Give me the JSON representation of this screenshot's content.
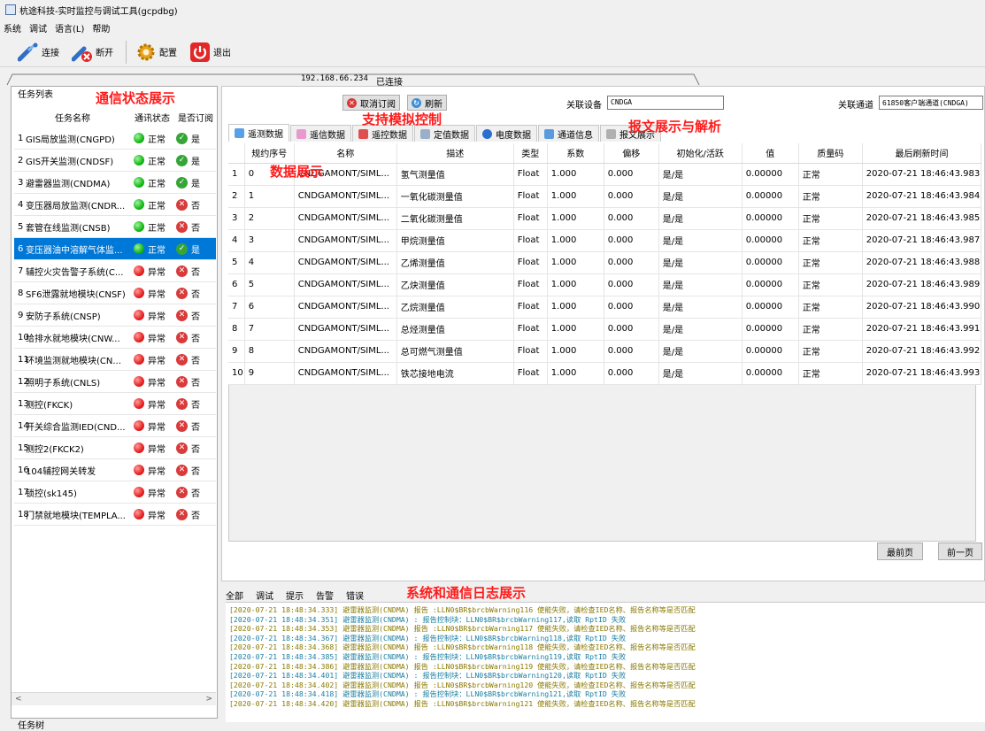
{
  "window": {
    "title": "杭途科技-实时监控与调试工具(gcpdbg)"
  },
  "menu": [
    "系统",
    "调试",
    "语言(L)",
    "帮助"
  ],
  "toolbar": {
    "connect": "连接",
    "disconnect": "断开",
    "config": "配置",
    "exit": "退出"
  },
  "address_bar": {
    "ip": "192.168.66.234",
    "status": "已连接"
  },
  "left_panel": {
    "title": "任务列表",
    "columns": [
      "任务名称",
      "通讯状态",
      "是否订阅"
    ],
    "footer": "任务树",
    "tasks": [
      {
        "num": "1",
        "name": "GIS局放监测(CNGPD)",
        "status": "正常",
        "status_ok": true,
        "sub": "是",
        "sub_yes": true
      },
      {
        "num": "2",
        "name": "GIS开关监测(CNDSF)",
        "status": "正常",
        "status_ok": true,
        "sub": "是",
        "sub_yes": true
      },
      {
        "num": "3",
        "name": "避雷器监测(CNDMA)",
        "status": "正常",
        "status_ok": true,
        "sub": "是",
        "sub_yes": true
      },
      {
        "num": "4",
        "name": "变压器局放监测(CNDR...",
        "status": "正常",
        "status_ok": true,
        "sub": "否",
        "sub_yes": false
      },
      {
        "num": "5",
        "name": "套管在线监测(CNSB)",
        "status": "正常",
        "status_ok": true,
        "sub": "否",
        "sub_yes": false
      },
      {
        "num": "6",
        "name": "变压器油中溶解气体监...",
        "status": "正常",
        "status_ok": true,
        "sub": "是",
        "sub_yes": true,
        "selected": true
      },
      {
        "num": "7",
        "name": "辅控火灾告警子系统(C...",
        "status": "异常",
        "status_ok": false,
        "sub": "否",
        "sub_yes": false
      },
      {
        "num": "8",
        "name": "SF6泄露就地模块(CNSF)",
        "status": "异常",
        "status_ok": false,
        "sub": "否",
        "sub_yes": false
      },
      {
        "num": "9",
        "name": "安防子系统(CNSP)",
        "status": "异常",
        "status_ok": false,
        "sub": "否",
        "sub_yes": false
      },
      {
        "num": "10",
        "name": "给排水就地模块(CNW...",
        "status": "异常",
        "status_ok": false,
        "sub": "否",
        "sub_yes": false
      },
      {
        "num": "11",
        "name": "环境监测就地模块(CN...",
        "status": "异常",
        "status_ok": false,
        "sub": "否",
        "sub_yes": false
      },
      {
        "num": "12",
        "name": "照明子系统(CNLS)",
        "status": "异常",
        "status_ok": false,
        "sub": "否",
        "sub_yes": false
      },
      {
        "num": "13",
        "name": "测控(FKCK)",
        "status": "异常",
        "status_ok": false,
        "sub": "否",
        "sub_yes": false
      },
      {
        "num": "14",
        "name": "开关综合监测IED(CND...",
        "status": "异常",
        "status_ok": false,
        "sub": "否",
        "sub_yes": false
      },
      {
        "num": "15",
        "name": "测控2(FKCK2)",
        "status": "异常",
        "status_ok": false,
        "sub": "否",
        "sub_yes": false
      },
      {
        "num": "16",
        "name": "104辅控网关转发",
        "status": "异常",
        "status_ok": false,
        "sub": "否",
        "sub_yes": false
      },
      {
        "num": "17",
        "name": "锁控(sk145)",
        "status": "异常",
        "status_ok": false,
        "sub": "否",
        "sub_yes": false
      },
      {
        "num": "18",
        "name": "门禁就地模块(TEMPLA...",
        "status": "异常",
        "status_ok": false,
        "sub": "否",
        "sub_yes": false
      }
    ]
  },
  "controls": {
    "unsubscribe": "取消订阅",
    "refresh": "刷新",
    "device_label": "关联设备",
    "device_value": "CNDGA",
    "channel_label": "关联通道",
    "channel_value": "61850客户端通道(CNDGA)"
  },
  "tabs": [
    "遥测数据",
    "遥信数据",
    "遥控数据",
    "定值数据",
    "电度数据",
    "通道信息",
    "报文展示"
  ],
  "table": {
    "headers": [
      "规约序号",
      "名称",
      "描述",
      "类型",
      "系数",
      "偏移",
      "初始化/活跃",
      "值",
      "质量码",
      "最后刷新时间"
    ],
    "rows": [
      {
        "rownum": "1",
        "seq": "0",
        "name": "CNDGAMONT/SIML...",
        "desc": "氢气测量值",
        "type": "Float",
        "coef": "1.000",
        "offset": "0.000",
        "init": "是/是",
        "value": "0.00000",
        "quality": "正常",
        "time": "2020-07-21 18:46:43.983"
      },
      {
        "rownum": "2",
        "seq": "1",
        "name": "CNDGAMONT/SIML...",
        "desc": "一氧化碳测量值",
        "type": "Float",
        "coef": "1.000",
        "offset": "0.000",
        "init": "是/是",
        "value": "0.00000",
        "quality": "正常",
        "time": "2020-07-21 18:46:43.984"
      },
      {
        "rownum": "3",
        "seq": "2",
        "name": "CNDGAMONT/SIML...",
        "desc": "二氧化碳测量值",
        "type": "Float",
        "coef": "1.000",
        "offset": "0.000",
        "init": "是/是",
        "value": "0.00000",
        "quality": "正常",
        "time": "2020-07-21 18:46:43.985"
      },
      {
        "rownum": "4",
        "seq": "3",
        "name": "CNDGAMONT/SIML...",
        "desc": "甲烷测量值",
        "type": "Float",
        "coef": "1.000",
        "offset": "0.000",
        "init": "是/是",
        "value": "0.00000",
        "quality": "正常",
        "time": "2020-07-21 18:46:43.987"
      },
      {
        "rownum": "5",
        "seq": "4",
        "name": "CNDGAMONT/SIML...",
        "desc": "乙烯测量值",
        "type": "Float",
        "coef": "1.000",
        "offset": "0.000",
        "init": "是/是",
        "value": "0.00000",
        "quality": "正常",
        "time": "2020-07-21 18:46:43.988"
      },
      {
        "rownum": "6",
        "seq": "5",
        "name": "CNDGAMONT/SIML...",
        "desc": "乙炔测量值",
        "type": "Float",
        "coef": "1.000",
        "offset": "0.000",
        "init": "是/是",
        "value": "0.00000",
        "quality": "正常",
        "time": "2020-07-21 18:46:43.989"
      },
      {
        "rownum": "7",
        "seq": "6",
        "name": "CNDGAMONT/SIML...",
        "desc": "乙烷测量值",
        "type": "Float",
        "coef": "1.000",
        "offset": "0.000",
        "init": "是/是",
        "value": "0.00000",
        "quality": "正常",
        "time": "2020-07-21 18:46:43.990"
      },
      {
        "rownum": "8",
        "seq": "7",
        "name": "CNDGAMONT/SIML...",
        "desc": "总烃测量值",
        "type": "Float",
        "coef": "1.000",
        "offset": "0.000",
        "init": "是/是",
        "value": "0.00000",
        "quality": "正常",
        "time": "2020-07-21 18:46:43.991"
      },
      {
        "rownum": "9",
        "seq": "8",
        "name": "CNDGAMONT/SIML...",
        "desc": "总可燃气测量值",
        "type": "Float",
        "coef": "1.000",
        "offset": "0.000",
        "init": "是/是",
        "value": "0.00000",
        "quality": "正常",
        "time": "2020-07-21 18:46:43.992"
      },
      {
        "rownum": "10",
        "seq": "9",
        "name": "CNDGAMONT/SIML...",
        "desc": "铁芯接地电流",
        "type": "Float",
        "coef": "1.000",
        "offset": "0.000",
        "init": "是/是",
        "value": "0.00000",
        "quality": "正常",
        "time": "2020-07-21 18:46:43.993"
      }
    ]
  },
  "paging": {
    "first": "最前页",
    "prev": "前一页"
  },
  "log_tabs": [
    "全部",
    "调试",
    "提示",
    "告警",
    "错误"
  ],
  "log_lines": [
    {
      "text": "[2020-07-21 18:48:34.333] 避雷器监测(CNDMA) 报告 :LLN0$BR$brcbWarning116 使能失败，请检查IED名称、报告名称等是否匹配",
      "color": "#8a7a00"
    },
    {
      "text": "[2020-07-21 18:48:34.351] 避雷器监测(CNDMA) : 报告控制块：LLN0$BR$brcbWarning117,读取 RptID 失败",
      "color": "#1a7fa0"
    },
    {
      "text": "[2020-07-21 18:48:34.353] 避雷器监测(CNDMA) 报告 :LLN0$BR$brcbWarning117 使能失败，请检查IED名称、报告名称等是否匹配",
      "color": "#8a7a00"
    },
    {
      "text": "[2020-07-21 18:48:34.367] 避雷器监测(CNDMA) : 报告控制块：LLN0$BR$brcbWarning118,读取 RptID 失败",
      "color": "#1a7fa0"
    },
    {
      "text": "[2020-07-21 18:48:34.368] 避雷器监测(CNDMA) 报告 :LLN0$BR$brcbWarning118 使能失败，请检查IED名称、报告名称等是否匹配",
      "color": "#8a7a00"
    },
    {
      "text": "[2020-07-21 18:48:34.385] 避雷器监测(CNDMA) : 报告控制块：LLN0$BR$brcbWarning119,读取 RptID 失败",
      "color": "#1a7fa0"
    },
    {
      "text": "[2020-07-21 18:48:34.386] 避雷器监测(CNDMA) 报告 :LLN0$BR$brcbWarning119 使能失败，请检查IED名称、报告名称等是否匹配",
      "color": "#8a7a00"
    },
    {
      "text": "[2020-07-21 18:48:34.401] 避雷器监测(CNDMA) : 报告控制块：LLN0$BR$brcbWarning120,读取 RptID 失败",
      "color": "#1a7fa0"
    },
    {
      "text": "[2020-07-21 18:48:34.402] 避雷器监测(CNDMA) 报告 :LLN0$BR$brcbWarning120 使能失败，请检查IED名称、报告名称等是否匹配",
      "color": "#8a7a00"
    },
    {
      "text": "[2020-07-21 18:48:34.418] 避雷器监测(CNDMA) : 报告控制块：LLN0$BR$brcbWarning121,读取 RptID 失败",
      "color": "#1a7fa0"
    },
    {
      "text": "[2020-07-21 18:48:34.420] 避雷器监测(CNDMA) 报告 :LLN0$BR$brcbWarning121 使能失败，请检查IED名称、报告名称等是否匹配",
      "color": "#8a7a00"
    }
  ],
  "annotations": {
    "comm_status": "通信状态展示",
    "sim_control": "支持模拟控制",
    "msg_parse": "报文展示与解析",
    "data_display": "数据展示",
    "log_display": "系统和通信日志展示"
  },
  "colors": {
    "selection": "#0078d7",
    "ok_green": "#15b815",
    "err_red": "#e52020",
    "annotation": "#ff1a1a"
  }
}
